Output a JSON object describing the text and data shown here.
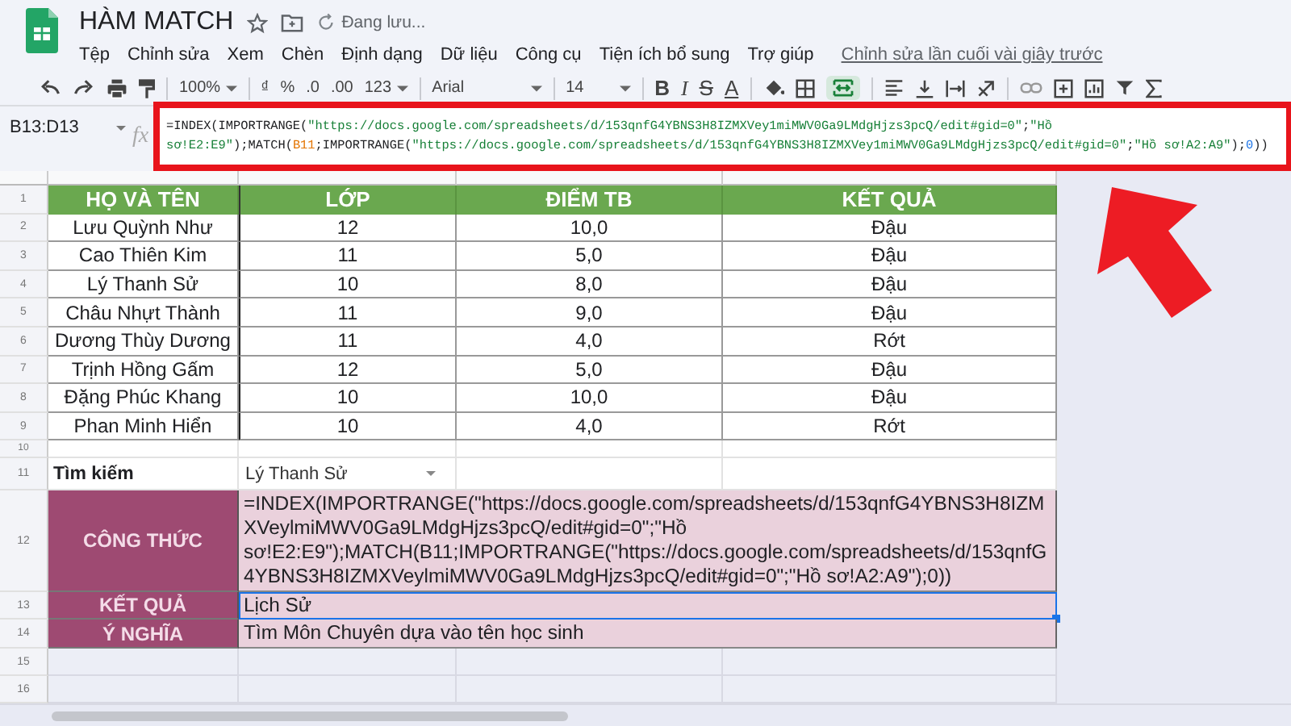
{
  "doc": {
    "title": "HÀM MATCH",
    "status": "Đang lưu...",
    "starred": false
  },
  "menu": [
    "Tệp",
    "Chỉnh sửa",
    "Xem",
    "Chèn",
    "Định dạng",
    "Dữ liệu",
    "Công cụ",
    "Tiện ích bổ sung",
    "Trợ giúp"
  ],
  "last_edit": "Chỉnh sửa lần cuối vài giây trước",
  "toolbar": {
    "zoom": "100%",
    "currency": "₫",
    "percent": "%",
    "decrease_decimals": ".0",
    "increase_decimals": ".00",
    "number_format": "123",
    "font": "Arial",
    "font_size": "14",
    "bold": "B",
    "italic": "I",
    "strikethrough": "S",
    "text_color": "A",
    "merge_on": true
  },
  "name_box": "B13:D13",
  "fx": "fx",
  "formula_lines": [
    [
      {
        "kind": "text",
        "t": "=INDEX(IMPORTRANGE("
      },
      {
        "kind": "string",
        "t": "\"https://docs.google.com/spreadsheets/d/153qnfG4YBNS3H8IZMXVey1miMWV0Ga9LMdgHjzs3pcQ/edit#gid=0\""
      },
      {
        "kind": "text",
        "t": ";"
      },
      {
        "kind": "string",
        "t": "\"Hồ"
      }
    ],
    [
      {
        "kind": "string",
        "t": "sơ!E2:E9\""
      },
      {
        "kind": "text",
        "t": ");MATCH("
      },
      {
        "kind": "ref",
        "t": "B11"
      },
      {
        "kind": "text",
        "t": ";IMPORTRANGE("
      },
      {
        "kind": "string",
        "t": "\"https://docs.google.com/spreadsheets/d/153qnfG4YBNS3H8IZMXVey1miMWV0Ga9LMdgHjzs3pcQ/edit#gid=0\""
      },
      {
        "kind": "text",
        "t": ";"
      },
      {
        "kind": "string",
        "t": "\"Hồ sơ!A2:A9\""
      },
      {
        "kind": "text",
        "t": ");"
      },
      {
        "kind": "number",
        "t": "0"
      },
      {
        "kind": "text",
        "t": "))"
      }
    ]
  ],
  "row_numbers": [
    "1",
    "2",
    "3",
    "4",
    "5",
    "6",
    "7",
    "8",
    "9",
    "10",
    "11",
    "12",
    "13",
    "14",
    "15",
    "16"
  ],
  "table": {
    "columns": [
      "HỌ VÀ TÊN",
      "LỚP",
      "ĐIỂM TB",
      "KẾT QUẢ"
    ],
    "rows": [
      [
        "Lưu Quỳnh Như",
        "12",
        "10,0",
        "Đậu"
      ],
      [
        "Cao Thiên Kim",
        "11",
        "5,0",
        "Đậu"
      ],
      [
        "Lý Thanh Sử",
        "10",
        "8,0",
        "Đậu"
      ],
      [
        "Châu Nhựt Thành",
        "11",
        "9,0",
        "Đậu"
      ],
      [
        "Dương Thùy Dương",
        "11",
        "4,0",
        "Rớt"
      ],
      [
        "Trịnh Hồng Gấm",
        "12",
        "5,0",
        "Đậu"
      ],
      [
        "Đặng Phúc Khang",
        "10",
        "10,0",
        "Đậu"
      ],
      [
        "Phan Minh Hiển",
        "10",
        "4,0",
        "Rớt"
      ]
    ]
  },
  "search": {
    "label": "Tìm kiếm",
    "value": "Lý Thanh Sử"
  },
  "results": [
    {
      "label": "CÔNG THỨC",
      "value": "=INDEX(IMPORTRANGE(\"https://docs.google.com/spreadsheets/d/153qnfG4YBNS3H8IZMXVeylmiMWV0Ga9LMdgHjzs3pcQ/edit#gid=0\";\"Hồ sơ!E2:E9\");MATCH(B11;IMPORTRANGE(\"https://docs.google.com/spreadsheets/d/153qnfG4YBNS3H8IZMXVeylmiMWV0Ga9LMdgHjzs3pcQ/edit#gid=0\";\"Hồ sơ!A2:A9\");0))",
      "selected": false
    },
    {
      "label": "KẾT QUẢ",
      "value": "Lịch Sử",
      "selected": true
    },
    {
      "label": "Ý NGHĨA",
      "value": "Tìm Môn Chuyên dựa vào tên học sinh",
      "selected": false
    }
  ]
}
